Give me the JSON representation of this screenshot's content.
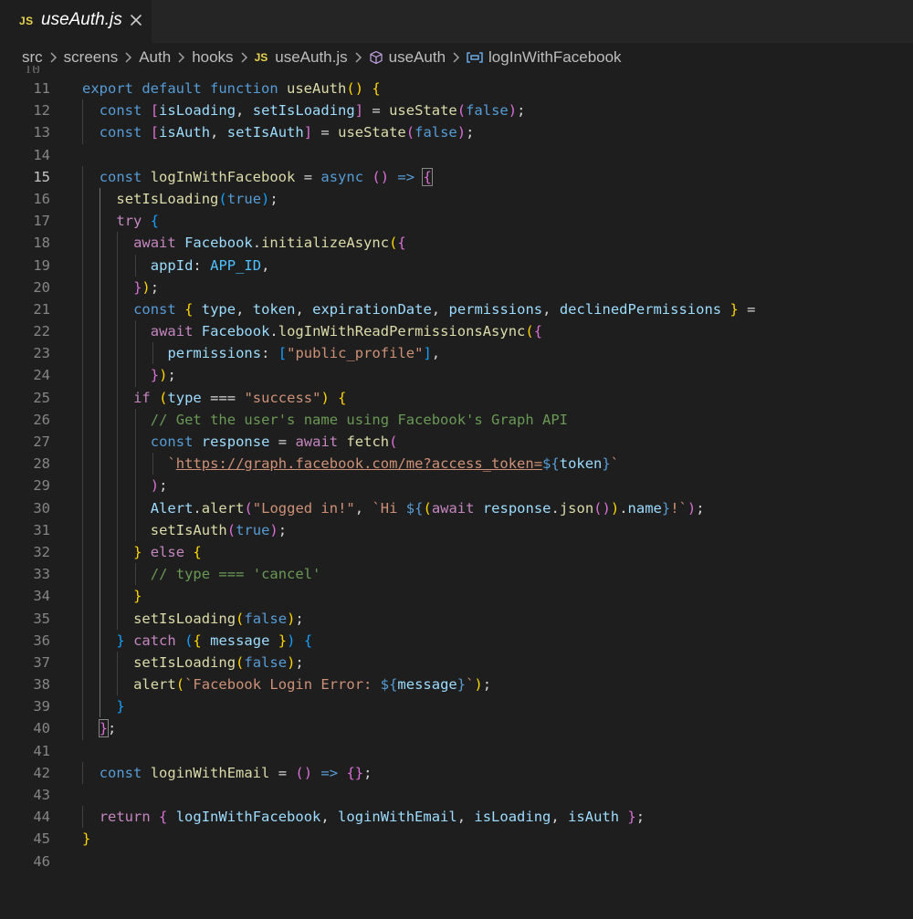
{
  "tab": {
    "badge": "JS",
    "title": "useAuth.js",
    "close_icon": "close-icon"
  },
  "breadcrumb": {
    "items": [
      "src",
      "screens",
      "Auth",
      "hooks",
      "useAuth.js",
      "useAuth",
      "logInWithFacebook"
    ],
    "file_badge": "JS",
    "separator_icon": "chevron-right-icon",
    "symbol_icons": [
      "cube-icon",
      "variable-icon"
    ]
  },
  "editor": {
    "active_line": 15,
    "line_numbers": [
      "11",
      "12",
      "13",
      "14",
      "15",
      "16",
      "17",
      "18",
      "19",
      "20",
      "21",
      "22",
      "23",
      "24",
      "25",
      "26",
      "27",
      "28",
      "29",
      "30",
      "31",
      "32",
      "33",
      "34",
      "35",
      "36",
      "37",
      "38",
      "39",
      "40",
      "41",
      "42",
      "43",
      "44",
      "45",
      "46"
    ],
    "lines": [
      "export default function useAuth() {",
      "  const [isLoading, setIsLoading] = useState(false);",
      "  const [isAuth, setIsAuth] = useState(false);",
      "",
      "  const logInWithFacebook = async () => {",
      "    setIsLoading(true);",
      "    try {",
      "      await Facebook.initializeAsync({",
      "        appId: APP_ID,",
      "      });",
      "      const { type, token, expirationDate, permissions, declinedPermissions } =",
      "        await Facebook.logInWithReadPermissionsAsync({",
      "          permissions: [\"public_profile\"],",
      "        });",
      "      if (type === \"success\") {",
      "        // Get the user's name using Facebook's Graph API",
      "        const response = await fetch(",
      "          `https://graph.facebook.com/me?access_token=${token}`",
      "        );",
      "        Alert.alert(\"Logged in!\", `Hi ${(await response.json()).name}!`);",
      "        setIsAuth(true);",
      "      } else {",
      "        // type === 'cancel'",
      "      }",
      "      setIsLoading(false);",
      "    } catch ({ message }) {",
      "      setIsLoading(false);",
      "      alert(`Facebook Login Error: ${message}`);",
      "    }",
      "  };",
      "",
      "  const loginWithEmail = () => {};",
      "",
      "  return { logInWithFacebook, loginWithEmail, isLoading, isAuth };",
      "}",
      ""
    ]
  },
  "colors": {
    "background": "#1e1e1e",
    "tabbar": "#252526",
    "keyword": "#569cd6",
    "control": "#c586c0",
    "function": "#dcdcaa",
    "variable": "#9cdcfe",
    "string": "#ce9178",
    "comment": "#6a9955"
  }
}
